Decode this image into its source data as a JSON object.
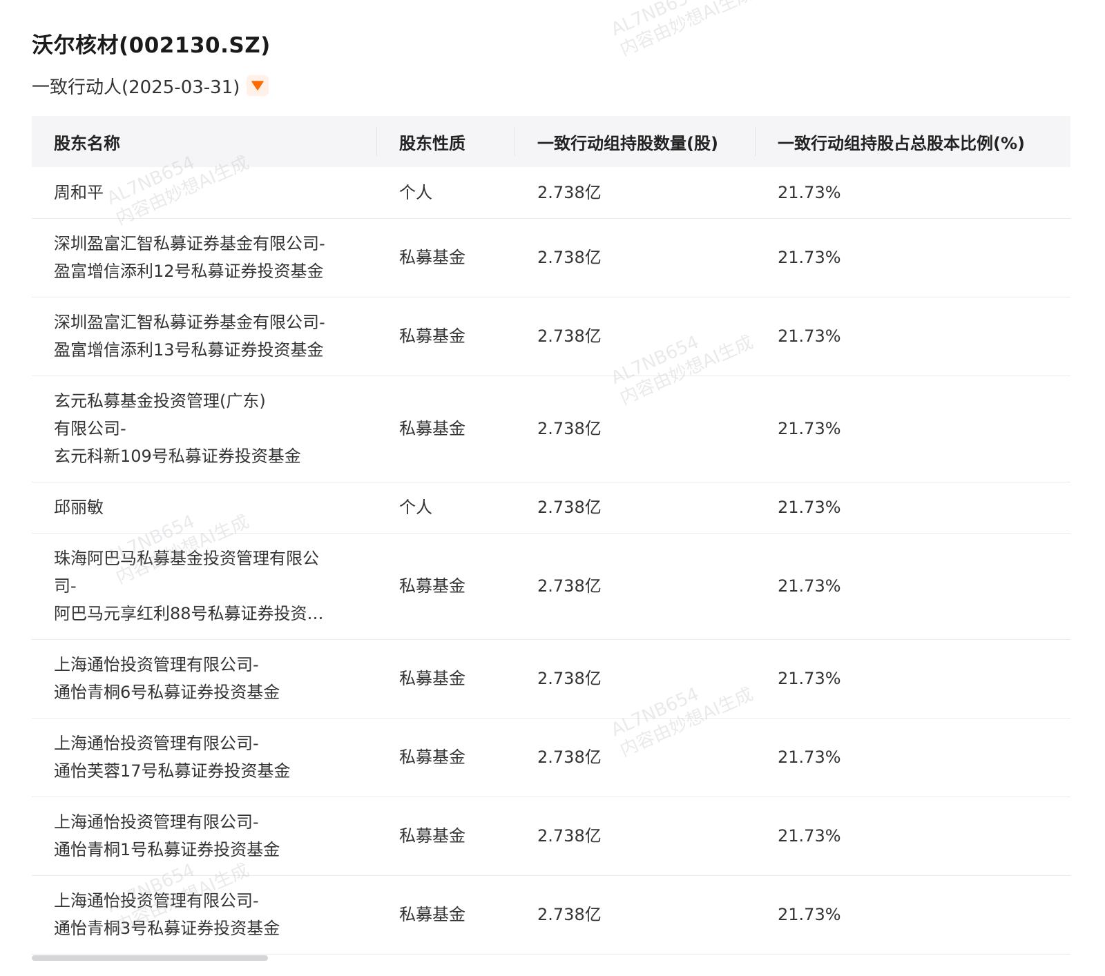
{
  "header": {
    "title": "沃尔核材(002130.SZ)",
    "subtitle": "一致行动人(2025-03-31)"
  },
  "icons": {
    "dropdown": "caret-down-icon",
    "accent_color": "#ff6a00"
  },
  "table": {
    "columns": [
      "股东名称",
      "股东性质",
      "一致行动组持股数量(股)",
      "一致行动组持股占总股本比例(%)"
    ],
    "rows": [
      {
        "name_lines": [
          "周和平"
        ],
        "type": "个人",
        "shares": "2.738亿",
        "ratio": "21.73%"
      },
      {
        "name_lines": [
          "深圳盈富汇智私募证券基金有限公司-",
          "盈富增信添利12号私募证券投资基金"
        ],
        "type": "私募基金",
        "shares": "2.738亿",
        "ratio": "21.73%"
      },
      {
        "name_lines": [
          "深圳盈富汇智私募证券基金有限公司-",
          "盈富增信添利13号私募证券投资基金"
        ],
        "type": "私募基金",
        "shares": "2.738亿",
        "ratio": "21.73%"
      },
      {
        "name_lines": [
          "玄元私募基金投资管理(广东)",
          "有限公司-",
          "玄元科新109号私募证券投资基金"
        ],
        "type": "私募基金",
        "shares": "2.738亿",
        "ratio": "21.73%"
      },
      {
        "name_lines": [
          "邱丽敏"
        ],
        "type": "个人",
        "shares": "2.738亿",
        "ratio": "21.73%"
      },
      {
        "name_lines": [
          "珠海阿巴马私募基金投资管理有限公",
          "司-",
          "阿巴马元享红利88号私募证券投资…"
        ],
        "type": "私募基金",
        "shares": "2.738亿",
        "ratio": "21.73%"
      },
      {
        "name_lines": [
          "上海通怡投资管理有限公司-",
          "通怡青桐6号私募证券投资基金"
        ],
        "type": "私募基金",
        "shares": "2.738亿",
        "ratio": "21.73%"
      },
      {
        "name_lines": [
          "上海通怡投资管理有限公司-",
          "通怡芙蓉17号私募证券投资基金"
        ],
        "type": "私募基金",
        "shares": "2.738亿",
        "ratio": "21.73%"
      },
      {
        "name_lines": [
          "上海通怡投资管理有限公司-",
          "通怡青桐1号私募证券投资基金"
        ],
        "type": "私募基金",
        "shares": "2.738亿",
        "ratio": "21.73%"
      },
      {
        "name_lines": [
          "上海通怡投资管理有限公司-",
          "通怡青桐3号私募证券投资基金"
        ],
        "type": "私募基金",
        "shares": "2.738亿",
        "ratio": "21.73%"
      }
    ]
  },
  "watermark": {
    "line1": "AL7NB654",
    "line2": "内容由妙想AI生成"
  }
}
